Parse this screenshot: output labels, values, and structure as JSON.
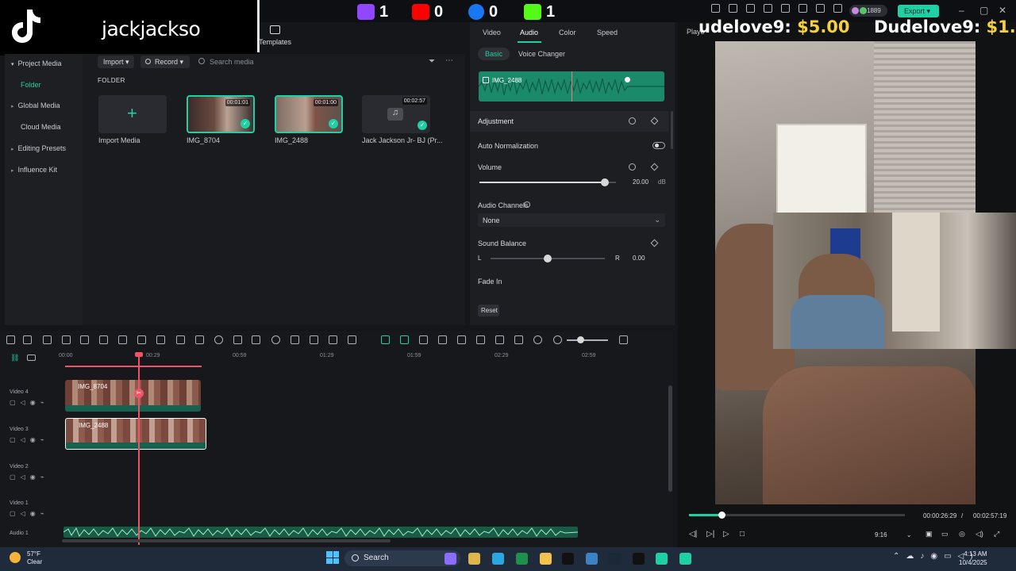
{
  "overlay": {
    "tiktok_username": "jackjackso",
    "counters": [
      {
        "platform": "twitch-icon",
        "value": "1",
        "color": "#9146ff"
      },
      {
        "platform": "youtube-icon",
        "value": "0",
        "color": "#ff0000"
      },
      {
        "platform": "facebook-icon",
        "value": "0",
        "color": "#1877f2"
      },
      {
        "platform": "kick-icon",
        "value": "1",
        "color": "#53fc18"
      }
    ],
    "donations": [
      {
        "name": "udelove9:",
        "amount": "$5.00"
      },
      {
        "name": "Dudelove9:",
        "amount": "$1."
      }
    ]
  },
  "header": {
    "templates_label": "Templates",
    "coins": "1889",
    "export_label": "Export",
    "accent": "#1fd0a4"
  },
  "media_panel": {
    "nav": [
      {
        "label": "Project Media"
      },
      {
        "label": "Folder"
      },
      {
        "label": "Global Media"
      },
      {
        "label": "Cloud Media"
      },
      {
        "label": "Editing Presets"
      },
      {
        "label": "Influence Kit"
      }
    ],
    "import_label": "Import",
    "record_label": "Record",
    "search_placeholder": "Search media",
    "folder_heading": "FOLDER",
    "items": [
      {
        "name": "Import Media",
        "duration": ""
      },
      {
        "name": "IMG_8704",
        "duration": "00:01:01"
      },
      {
        "name": "IMG_2488",
        "duration": "00:01:00"
      },
      {
        "name": "Jack Jackson Jr- BJ (Pr...",
        "duration": "00:02:57"
      }
    ]
  },
  "properties": {
    "tabs": [
      "Video",
      "Audio",
      "Color",
      "Speed"
    ],
    "active_tab": "Audio",
    "subtabs": [
      "Basic",
      "Voice Changer"
    ],
    "clip_name": "IMG_2488",
    "adjustment_label": "Adjustment",
    "auto_normalization_label": "Auto Normalization",
    "volume_label": "Volume",
    "volume_value": "20.00",
    "volume_unit": "dB",
    "volume_level": 0.92,
    "audio_channels_label": "Audio Channels",
    "audio_channels_value": "None",
    "sound_balance_label": "Sound Balance",
    "balance_left": "L",
    "balance_right": "R",
    "balance_value": "0.00",
    "balance_level": 0.5,
    "fade_in_label": "Fade In",
    "reset_label": "Reset"
  },
  "player": {
    "label": "Playe",
    "current_time": "00:00:26:29",
    "separator": "/",
    "total_time": "00:02:57:19",
    "progress": 0.15,
    "ratio": "9:16"
  },
  "timeline": {
    "ruler": [
      "00:00",
      "00:29",
      "00:59",
      "01:29",
      "01:59",
      "02:29",
      "02:59"
    ],
    "tracks": [
      {
        "name": "Video 4"
      },
      {
        "name": "Video 3"
      },
      {
        "name": "Video 2"
      },
      {
        "name": "Video 1"
      },
      {
        "name": "Audio 1"
      }
    ],
    "clips": [
      {
        "name": "IMG_8704",
        "track": "Video 4"
      },
      {
        "name": "IMG_2488",
        "track": "Video 3"
      }
    ]
  },
  "taskbar": {
    "temperature": "57°F",
    "weather": "Clear",
    "search_label": "Search",
    "time": "4:13 AM",
    "date": "10/4/2025"
  }
}
